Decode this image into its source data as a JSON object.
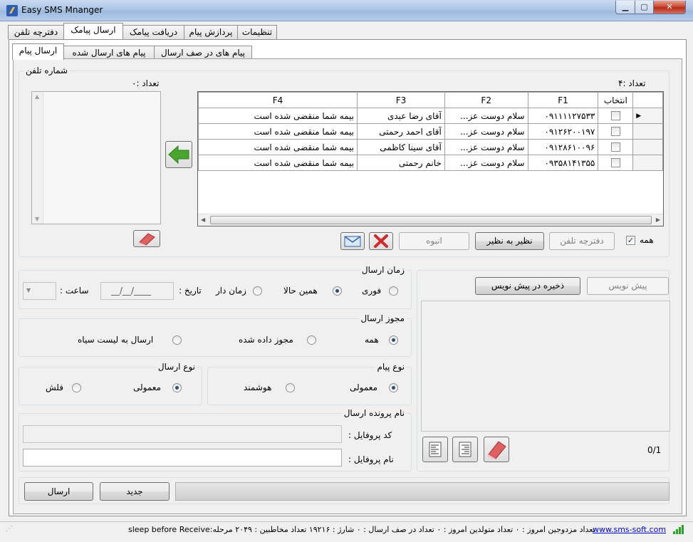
{
  "window": {
    "title": "Easy SMS Mnanger"
  },
  "main_tabs": [
    "تنظیمات",
    "پردازش پیام",
    "دریافت پیامک",
    "ارسال پیامک",
    "دفترچه تلفن"
  ],
  "sub_tabs": [
    "پیام های در صف ارسال",
    "پیام های ارسال شده",
    "ارسال پیام"
  ],
  "phone_group": {
    "title": "شماره تلفن",
    "left_count": "تعداد :۰",
    "right_count": "تعداد :۴",
    "grid": {
      "headers": [
        "انتخاب",
        "F1",
        "F2",
        "F3",
        "F4"
      ],
      "rows": [
        [
          "",
          "۰۹۱۱۱۱۲۷۵۳۳",
          "سلام دوست عز...",
          "آقای رضا عبدی",
          "بیمه شما منقضی شده است"
        ],
        [
          "",
          "۰۹۱۲۶۲۰۰۱۹۷",
          "سلام دوست عز...",
          "آقای احمد رحمتی",
          "بیمه شما منقضی شده است"
        ],
        [
          "",
          "۰۹۱۲۸۶۱۰۰۹۶",
          "سلام دوست عز...",
          "آقای سینا کاظمی",
          "بیمه شما منقضی شده است"
        ],
        [
          "",
          "۰۹۳۵۸۱۴۱۳۵۵",
          "سلام دوست عز...",
          "خانم رحمتی",
          "بیمه شما منقضی شده است"
        ]
      ]
    },
    "buttons": {
      "all": "همه",
      "phonebook": "دفترچه تلفن",
      "peer": "نظیر به نظیر",
      "bulk": "انبوه"
    }
  },
  "send_time": {
    "title": "زمان ارسال",
    "options": [
      "فوری",
      "همین حالا",
      "زمان دار"
    ],
    "date_label": "تاریخ :",
    "date_placeholder": "__/__/____",
    "time_label": "ساعت :"
  },
  "permission": {
    "title": "مجوز ارسال",
    "options": [
      "همه",
      "مجوز داده شده",
      "ارسال به لیست سیاه"
    ]
  },
  "send_type": {
    "title": "نوع ارسال",
    "options": [
      "معمولی",
      "فلش"
    ]
  },
  "message_type": {
    "title": "نوع پیام",
    "options": [
      "معمولی",
      "هوشمند"
    ]
  },
  "profile": {
    "title": "نام پرونده ارسال",
    "code_label": "کد پروفایل :",
    "name_label": "نام پروفایل :"
  },
  "draft": {
    "drafts_button": "پیش نویس",
    "save_button": "ذخیره در پیش نویس",
    "counter": "0/1"
  },
  "actions": {
    "send": "ارسال",
    "new": "جدید"
  },
  "status": {
    "link": "www.sms-soft.com",
    "text": "تعداد مزدوجین امروز : ۰   تعداد متولدین امروز : ۰   تعداد در صف ارسال : ۰   شارژ : ۱۹۲۱۶   تعداد مخاطبین : ۲۰۴۹   مرحله:sleep before Receive"
  },
  "colors": {
    "title_bar": "#b7cde9",
    "link": "#0000cc",
    "arrow": "#4aa52e",
    "delete_red": "#d22a2a"
  }
}
